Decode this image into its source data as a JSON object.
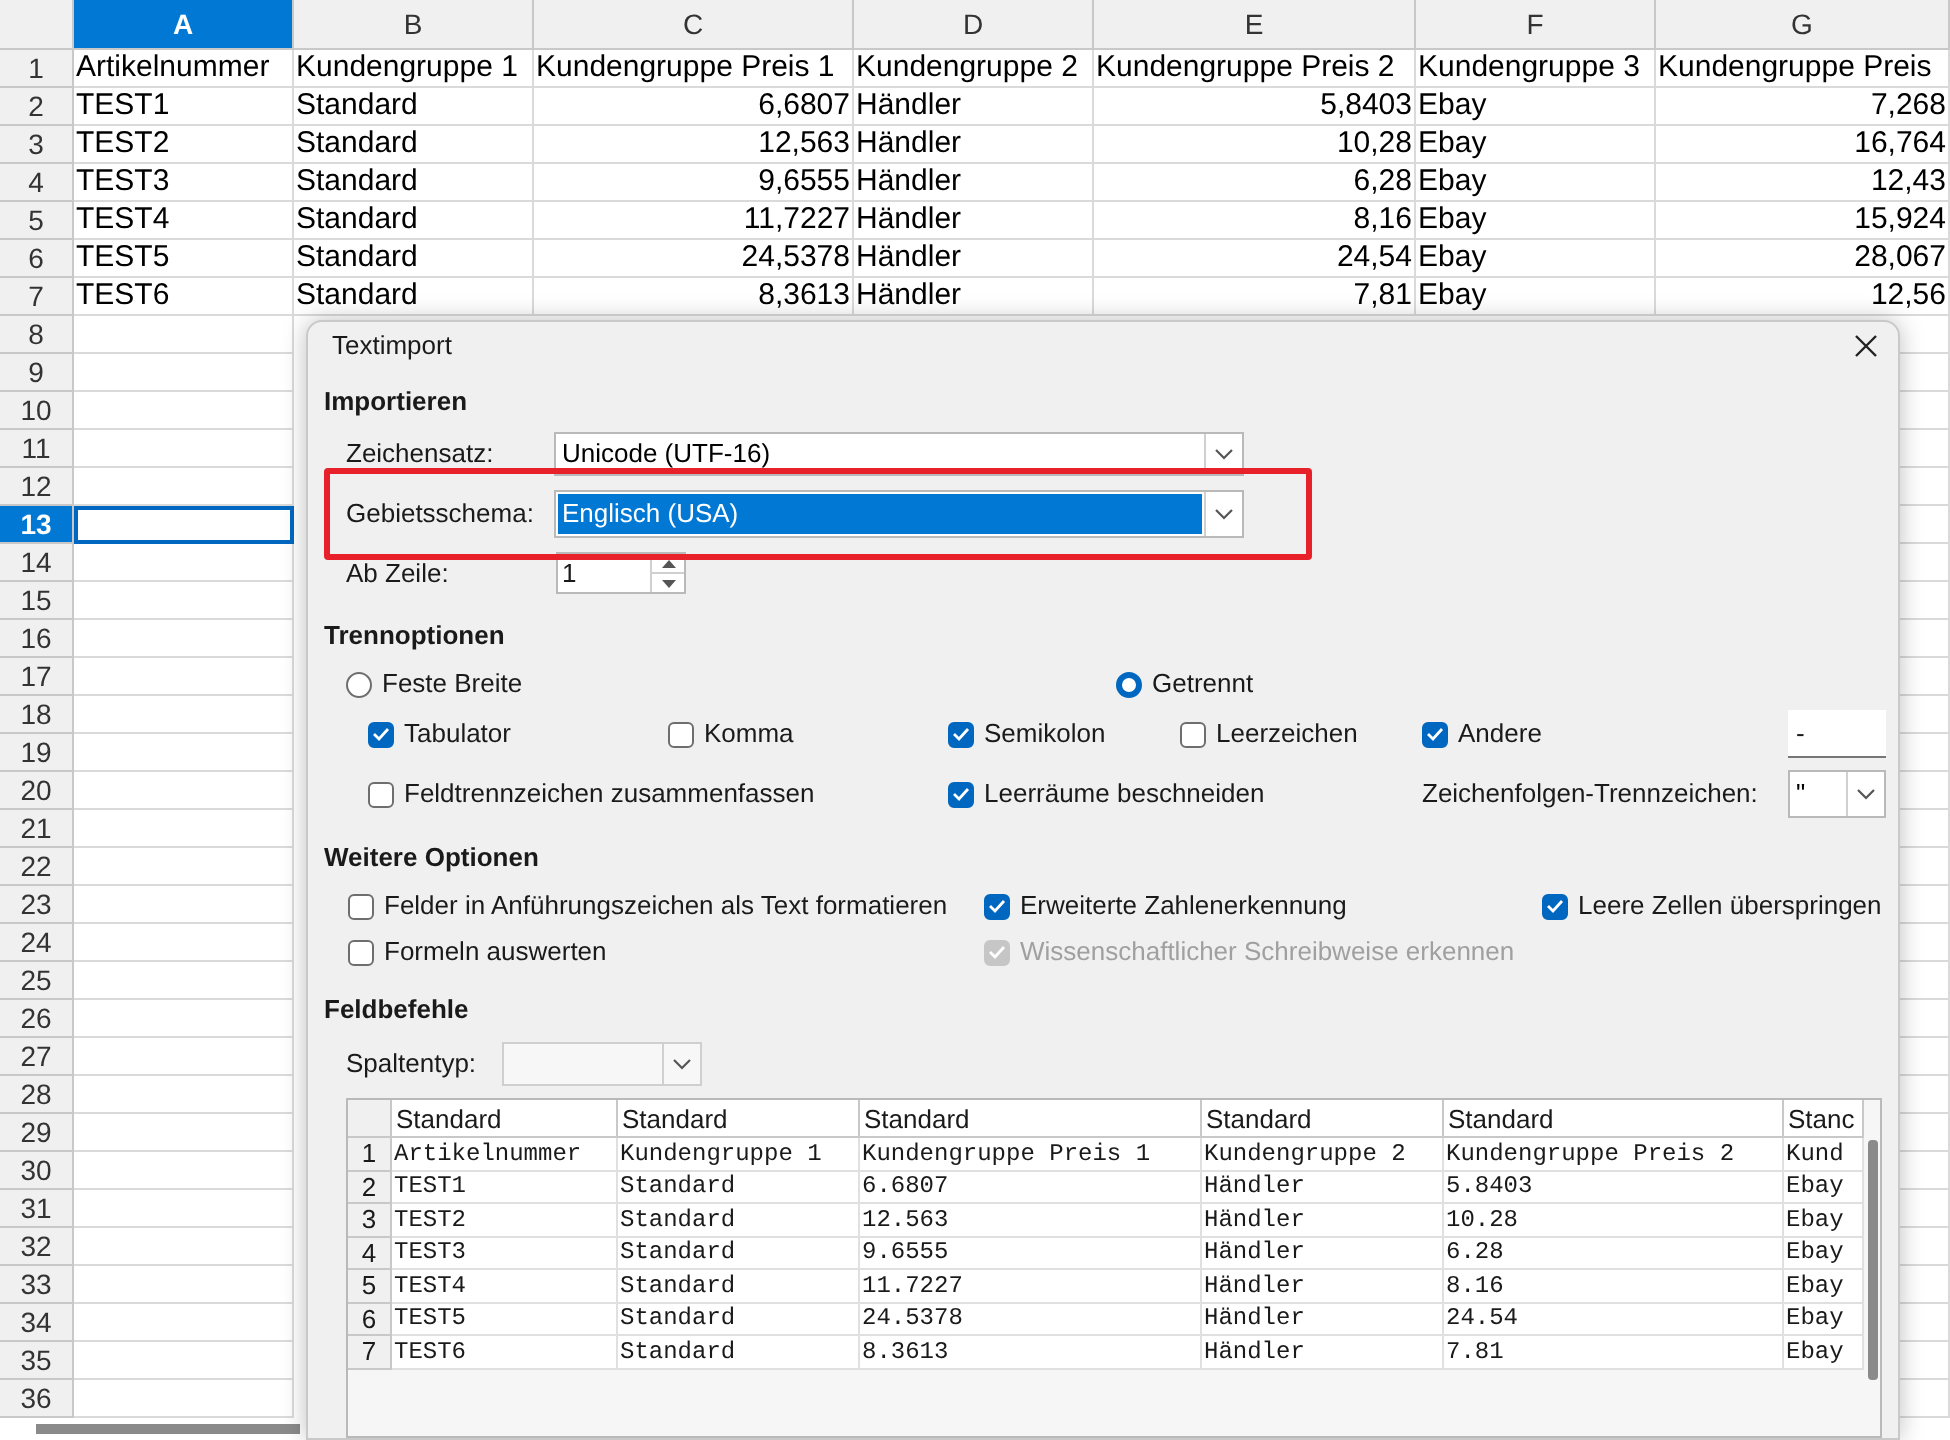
{
  "spreadsheet": {
    "columns": [
      {
        "label": "A",
        "selected": true
      },
      {
        "label": "B",
        "selected": false
      },
      {
        "label": "C",
        "selected": false
      },
      {
        "label": "D",
        "selected": false
      },
      {
        "label": "E",
        "selected": false
      },
      {
        "label": "F",
        "selected": false
      },
      {
        "label": "G",
        "selected": false
      }
    ],
    "rows": [
      {
        "label": "1",
        "selected": false,
        "cells": [
          {
            "text": "Artikelnummer",
            "kind": "text"
          },
          {
            "text": "Kundengruppe 1",
            "kind": "text"
          },
          {
            "text": "Kundengruppe Preis 1",
            "kind": "text"
          },
          {
            "text": "Kundengruppe 2",
            "kind": "text"
          },
          {
            "text": "Kundengruppe Preis 2",
            "kind": "text"
          },
          {
            "text": "Kundengruppe 3",
            "kind": "text"
          },
          {
            "text": "Kundengruppe Preis",
            "kind": "text"
          }
        ]
      },
      {
        "label": "2",
        "selected": false,
        "cells": [
          {
            "text": "TEST1",
            "kind": "text"
          },
          {
            "text": "Standard",
            "kind": "text"
          },
          {
            "text": "6,6807",
            "kind": "number"
          },
          {
            "text": "Händler",
            "kind": "text"
          },
          {
            "text": "5,8403",
            "kind": "number"
          },
          {
            "text": "Ebay",
            "kind": "text"
          },
          {
            "text": "7,268",
            "kind": "number"
          }
        ]
      },
      {
        "label": "3",
        "selected": false,
        "cells": [
          {
            "text": "TEST2",
            "kind": "text"
          },
          {
            "text": "Standard",
            "kind": "text"
          },
          {
            "text": "12,563",
            "kind": "number"
          },
          {
            "text": "Händler",
            "kind": "text"
          },
          {
            "text": "10,28",
            "kind": "number"
          },
          {
            "text": "Ebay",
            "kind": "text"
          },
          {
            "text": "16,764",
            "kind": "number"
          }
        ]
      },
      {
        "label": "4",
        "selected": false,
        "cells": [
          {
            "text": "TEST3",
            "kind": "text"
          },
          {
            "text": "Standard",
            "kind": "text"
          },
          {
            "text": "9,6555",
            "kind": "number"
          },
          {
            "text": "Händler",
            "kind": "text"
          },
          {
            "text": "6,28",
            "kind": "number"
          },
          {
            "text": "Ebay",
            "kind": "text"
          },
          {
            "text": "12,43",
            "kind": "number"
          }
        ]
      },
      {
        "label": "5",
        "selected": false,
        "cells": [
          {
            "text": "TEST4",
            "kind": "text"
          },
          {
            "text": "Standard",
            "kind": "text"
          },
          {
            "text": "11,7227",
            "kind": "number"
          },
          {
            "text": "Händler",
            "kind": "text"
          },
          {
            "text": "8,16",
            "kind": "number"
          },
          {
            "text": "Ebay",
            "kind": "text"
          },
          {
            "text": "15,924",
            "kind": "number"
          }
        ]
      },
      {
        "label": "6",
        "selected": false,
        "cells": [
          {
            "text": "TEST5",
            "kind": "text"
          },
          {
            "text": "Standard",
            "kind": "text"
          },
          {
            "text": "24,5378",
            "kind": "number"
          },
          {
            "text": "Händler",
            "kind": "text"
          },
          {
            "text": "24,54",
            "kind": "number"
          },
          {
            "text": "Ebay",
            "kind": "text"
          },
          {
            "text": "28,067",
            "kind": "number"
          }
        ]
      },
      {
        "label": "7",
        "selected": false,
        "cells": [
          {
            "text": "TEST6",
            "kind": "text"
          },
          {
            "text": "Standard",
            "kind": "text"
          },
          {
            "text": "8,3613",
            "kind": "number"
          },
          {
            "text": "Händler",
            "kind": "text"
          },
          {
            "text": "7,81",
            "kind": "number"
          },
          {
            "text": "Ebay",
            "kind": "text"
          },
          {
            "text": "12,56",
            "kind": "number"
          }
        ]
      },
      {
        "label": "8",
        "selected": false
      },
      {
        "label": "9",
        "selected": false
      },
      {
        "label": "10",
        "selected": false
      },
      {
        "label": "11",
        "selected": false
      },
      {
        "label": "12",
        "selected": false
      },
      {
        "label": "13",
        "selected": true
      },
      {
        "label": "14",
        "selected": false
      },
      {
        "label": "15",
        "selected": false
      },
      {
        "label": "16",
        "selected": false
      },
      {
        "label": "17",
        "selected": false
      },
      {
        "label": "18",
        "selected": false
      },
      {
        "label": "19",
        "selected": false
      },
      {
        "label": "20",
        "selected": false
      },
      {
        "label": "21",
        "selected": false
      },
      {
        "label": "22",
        "selected": false
      },
      {
        "label": "23",
        "selected": false
      },
      {
        "label": "24",
        "selected": false
      },
      {
        "label": "25",
        "selected": false
      },
      {
        "label": "26",
        "selected": false
      },
      {
        "label": "27",
        "selected": false
      },
      {
        "label": "28",
        "selected": false
      },
      {
        "label": "29",
        "selected": false
      },
      {
        "label": "30",
        "selected": false
      },
      {
        "label": "31",
        "selected": false
      },
      {
        "label": "32",
        "selected": false
      },
      {
        "label": "33",
        "selected": false
      },
      {
        "label": "34",
        "selected": false
      },
      {
        "label": "35",
        "selected": false
      },
      {
        "label": "36",
        "selected": false
      }
    ]
  },
  "dialog": {
    "title": "Textimport",
    "import": {
      "heading": "Importieren",
      "charset": {
        "label": "Zeichensatz:",
        "value": "Unicode (UTF-16)"
      },
      "locale": {
        "label": "Gebietsschema:",
        "value": "Englisch (USA)",
        "selected": true,
        "highlighted": true
      },
      "from_row": {
        "label": "Ab Zeile:",
        "value": "1"
      }
    },
    "separator_options": {
      "heading": "Trennoptionen",
      "modes": [
        {
          "label": "Feste Breite",
          "selected": false
        },
        {
          "label": "Getrennt",
          "selected": true
        }
      ],
      "separators": [
        {
          "label": "Tabulator",
          "checked": true
        },
        {
          "label": "Komma",
          "checked": false
        },
        {
          "label": "Semikolon",
          "checked": true
        },
        {
          "label": "Leerzeichen",
          "checked": false
        },
        {
          "label": "Andere",
          "checked": true
        }
      ],
      "other_value": "-",
      "merge": {
        "label": "Feldtrennzeichen zusammenfassen",
        "checked": false
      },
      "trim": {
        "label": "Leerräume beschneiden",
        "checked": true
      },
      "string_delimiter": {
        "label": "Zeichenfolgen-Trennzeichen:",
        "value": "\""
      }
    },
    "more_options": {
      "heading": "Weitere Optionen",
      "rows": [
        [
          {
            "label": "Felder in Anführungszeichen als Text formatieren",
            "checked": false,
            "disabled": false
          },
          {
            "label": "Erweiterte Zahlenerkennung",
            "checked": true,
            "disabled": false
          },
          {
            "label": "Leere Zellen überspringen",
            "checked": true,
            "disabled": false
          }
        ],
        [
          {
            "label": "Formeln auswerten",
            "checked": false,
            "disabled": false
          },
          {
            "label": "Wissenschaftlicher Schreibweise erkennen",
            "checked": true,
            "disabled": true
          }
        ]
      ]
    },
    "fields": {
      "heading": "Feldbefehle",
      "column_type": {
        "label": "Spaltentyp:",
        "disabled": true
      },
      "preview": {
        "column_types": [
          "Standard",
          "Standard",
          "Standard",
          "Standard",
          "Standard",
          "Stanc"
        ],
        "rows": [
          {
            "label": "1",
            "cells": [
              "Artikelnummer",
              "Kundengruppe 1",
              "Kundengruppe Preis 1",
              "Kundengruppe 2",
              "Kundengruppe Preis 2",
              "Kund"
            ]
          },
          {
            "label": "2",
            "cells": [
              "TEST1",
              "Standard",
              "6.6807",
              "Händler",
              "5.8403",
              "Ebay"
            ]
          },
          {
            "label": "3",
            "cells": [
              "TEST2",
              "Standard",
              "12.563",
              "Händler",
              "10.28",
              "Ebay"
            ]
          },
          {
            "label": "4",
            "cells": [
              "TEST3",
              "Standard",
              "9.6555",
              "Händler",
              "6.28",
              "Ebay"
            ]
          },
          {
            "label": "5",
            "cells": [
              "TEST4",
              "Standard",
              "11.7227",
              "Händler",
              "8.16",
              "Ebay"
            ]
          },
          {
            "label": "6",
            "cells": [
              "TEST5",
              "Standard",
              "24.5378",
              "Händler",
              "24.54",
              "Ebay"
            ]
          },
          {
            "label": "7",
            "cells": [
              "TEST6",
              "Standard",
              "8.3613",
              "Händler",
              "7.81",
              "Ebay"
            ]
          }
        ]
      }
    }
  }
}
